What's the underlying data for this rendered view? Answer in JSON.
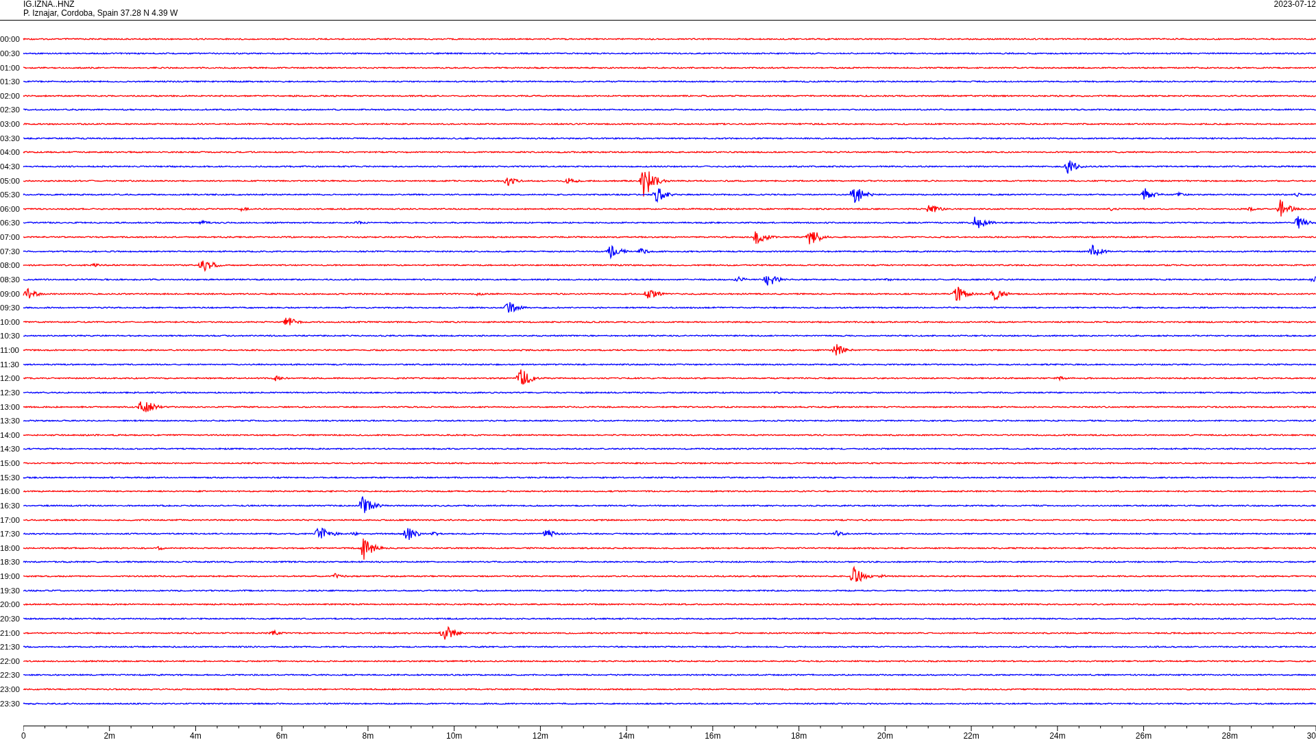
{
  "header": {
    "station": "IG.IZNA..HNZ",
    "location": "P. Iznajar, Cordoba, Spain  37.28 N 4.39 W",
    "date": "2023-07-12"
  },
  "rows": [
    {
      "time": "00:00",
      "color": "#ff0000"
    },
    {
      "time": "00:30",
      "color": "#0000ff"
    },
    {
      "time": "01:00",
      "color": "#ff0000"
    },
    {
      "time": "01:30",
      "color": "#0000ff"
    },
    {
      "time": "02:00",
      "color": "#ff0000"
    },
    {
      "time": "02:30",
      "color": "#0000ff"
    },
    {
      "time": "03:00",
      "color": "#ff0000"
    },
    {
      "time": "03:30",
      "color": "#0000ff"
    },
    {
      "time": "04:00",
      "color": "#ff0000"
    },
    {
      "time": "04:30",
      "color": "#0000ff"
    },
    {
      "time": "05:00",
      "color": "#ff0000"
    },
    {
      "time": "05:30",
      "color": "#0000ff"
    },
    {
      "time": "06:00",
      "color": "#ff0000"
    },
    {
      "time": "06:30",
      "color": "#0000ff"
    },
    {
      "time": "07:00",
      "color": "#ff0000"
    },
    {
      "time": "07:30",
      "color": "#0000ff"
    },
    {
      "time": "08:00",
      "color": "#ff0000"
    },
    {
      "time": "08:30",
      "color": "#0000ff"
    },
    {
      "time": "09:00",
      "color": "#ff0000"
    },
    {
      "time": "09:30",
      "color": "#0000ff"
    },
    {
      "time": "10:00",
      "color": "#ff0000"
    },
    {
      "time": "10:30",
      "color": "#0000ff"
    },
    {
      "time": "11:00",
      "color": "#ff0000"
    },
    {
      "time": "11:30",
      "color": "#0000ff"
    },
    {
      "time": "12:00",
      "color": "#ff0000"
    },
    {
      "time": "12:30",
      "color": "#0000ff"
    },
    {
      "time": "13:00",
      "color": "#ff0000"
    },
    {
      "time": "13:30",
      "color": "#0000ff"
    },
    {
      "time": "14:00",
      "color": "#ff0000"
    },
    {
      "time": "14:30",
      "color": "#0000ff"
    },
    {
      "time": "15:00",
      "color": "#ff0000"
    },
    {
      "time": "15:30",
      "color": "#0000ff"
    },
    {
      "time": "16:00",
      "color": "#ff0000"
    },
    {
      "time": "16:30",
      "color": "#0000ff"
    },
    {
      "time": "17:00",
      "color": "#ff0000"
    },
    {
      "time": "17:30",
      "color": "#0000ff"
    },
    {
      "time": "18:00",
      "color": "#ff0000"
    },
    {
      "time": "18:30",
      "color": "#0000ff"
    },
    {
      "time": "19:00",
      "color": "#ff0000"
    },
    {
      "time": "19:30",
      "color": "#0000ff"
    },
    {
      "time": "20:00",
      "color": "#ff0000"
    },
    {
      "time": "20:30",
      "color": "#0000ff"
    },
    {
      "time": "21:00",
      "color": "#ff0000"
    },
    {
      "time": "21:30",
      "color": "#0000ff"
    },
    {
      "time": "22:00",
      "color": "#ff0000"
    },
    {
      "time": "22:30",
      "color": "#0000ff"
    },
    {
      "time": "23:00",
      "color": "#ff0000"
    },
    {
      "time": "23:30",
      "color": "#0000ff"
    }
  ],
  "x_axis": {
    "labels": [
      "0",
      "2m",
      "4m",
      "6m",
      "8m",
      "10m",
      "12m",
      "14m",
      "16m",
      "18m",
      "20m",
      "22m",
      "24m",
      "26m",
      "28m",
      "30"
    ]
  }
}
